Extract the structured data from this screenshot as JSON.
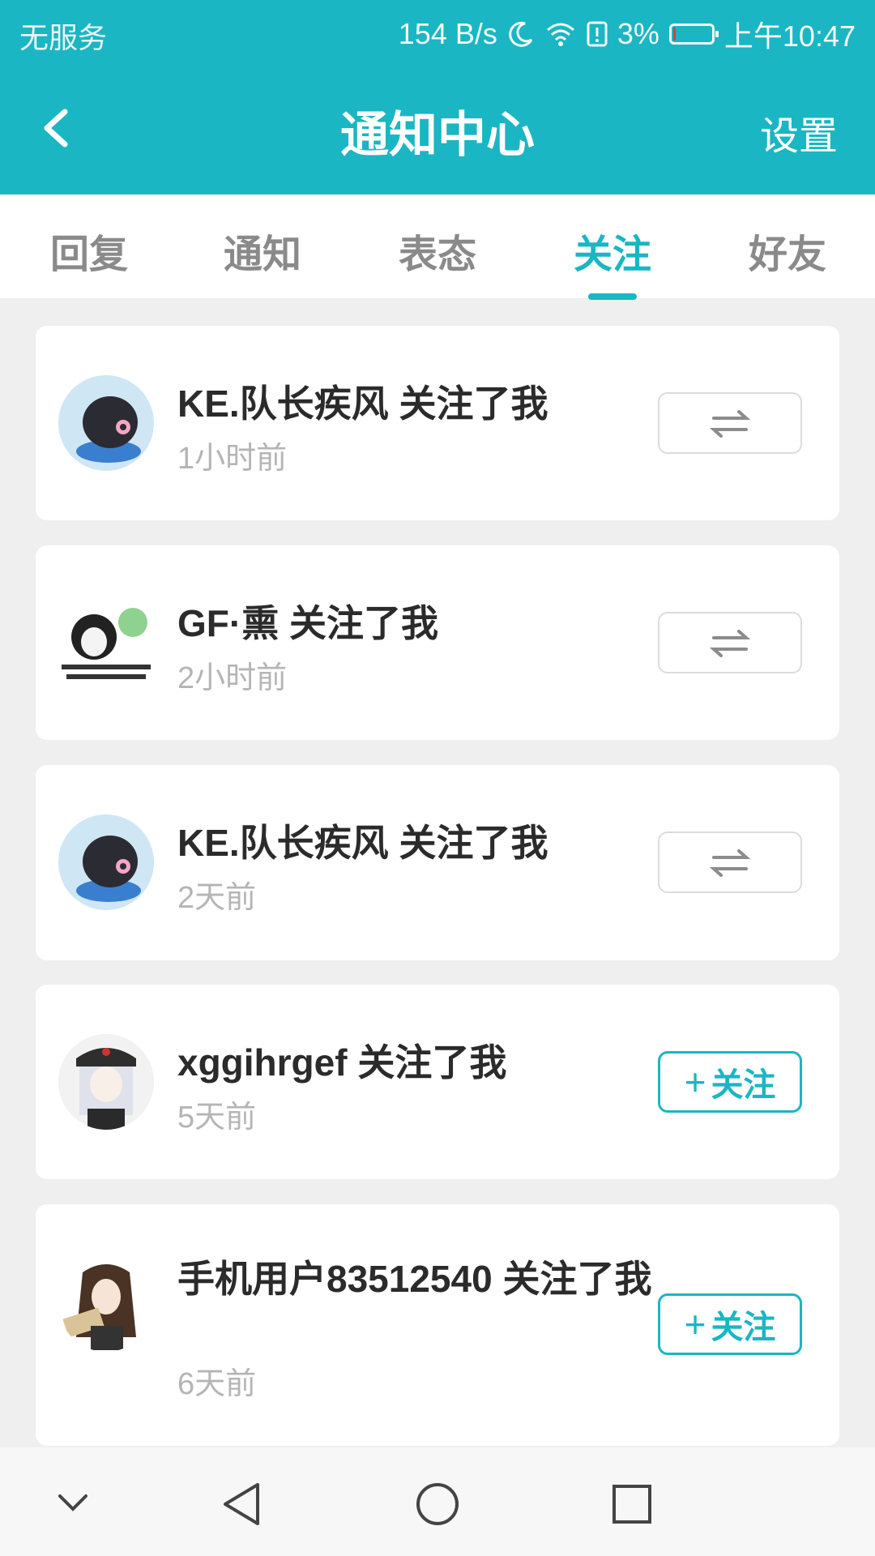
{
  "status_bar": {
    "carrier": "无服务",
    "net_speed": "154 B/s",
    "battery_pct": "3%",
    "battery_level": 0.03,
    "time": "上午10:47"
  },
  "header": {
    "title": "通知中心",
    "settings_label": "设置"
  },
  "tabs": [
    {
      "label": "回复",
      "active": false
    },
    {
      "label": "通知",
      "active": false
    },
    {
      "label": "表态",
      "active": false
    },
    {
      "label": "关注",
      "active": true
    },
    {
      "label": "好友",
      "active": false
    }
  ],
  "notifications": [
    {
      "title": "KE.队长疾风 关注了我",
      "time": "1小时前",
      "action": "swap-icon"
    },
    {
      "title": "GF·熏 关注了我",
      "time": "2小时前",
      "action": "swap-icon"
    },
    {
      "title": "KE.队长疾风 关注了我",
      "time": "2天前",
      "action": "swap-icon"
    },
    {
      "title": "xggihrgef 关注了我",
      "time": "5天前",
      "action": "follow",
      "action_label": "关注"
    },
    {
      "title": "手机用户83512540 关注了我",
      "time": "6天前",
      "action": "follow",
      "action_label": "关注"
    }
  ],
  "colors": {
    "accent": "#1ab6c3",
    "page_bg": "#efefef",
    "battery_low": "#e53935"
  },
  "nav": {
    "icons": [
      "chevron-down-icon",
      "back-triangle-icon",
      "home-circle-icon",
      "recents-square-icon"
    ]
  }
}
